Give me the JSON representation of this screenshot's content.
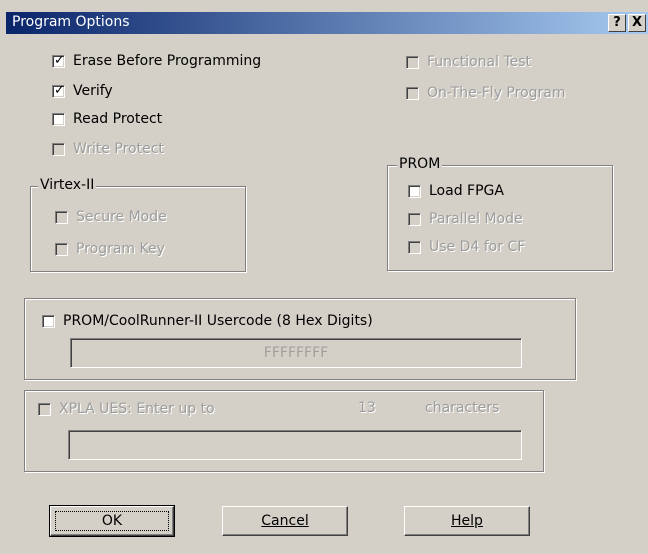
{
  "window": {
    "title": "Program Options",
    "help_button": "?",
    "close_button": "X"
  },
  "options": {
    "erase": {
      "label": "Erase Before Programming",
      "checked": true,
      "enabled": true
    },
    "verify": {
      "label": "Verify",
      "checked": true,
      "enabled": true
    },
    "read_protect": {
      "label": "Read Protect",
      "checked": false,
      "enabled": true
    },
    "write_protect": {
      "label": "Write Protect",
      "checked": false,
      "enabled": false
    },
    "functional_test": {
      "label": "Functional Test",
      "checked": false,
      "enabled": false
    },
    "on_the_fly": {
      "label": "On-The-Fly Program",
      "checked": false,
      "enabled": false
    }
  },
  "virtex": {
    "title": "Virtex-II",
    "secure_mode": {
      "label": "Secure Mode",
      "checked": false,
      "enabled": false
    },
    "program_key": {
      "label": "Program Key",
      "checked": false,
      "enabled": false
    }
  },
  "prom": {
    "title": "PROM",
    "load_fpga": {
      "label": "Load FPGA",
      "checked": false,
      "enabled": true
    },
    "parallel_mode": {
      "label": "Parallel Mode",
      "checked": false,
      "enabled": false
    },
    "use_d4": {
      "label": "Use D4 for CF",
      "checked": false,
      "enabled": false
    }
  },
  "usercode": {
    "label": "PROM/CoolRunner-II Usercode (8 Hex Digits)",
    "checked": false,
    "value": "FFFFFFFF"
  },
  "xpla": {
    "label": "XPLA UES: Enter up to",
    "count": "13",
    "suffix": "characters",
    "value": ""
  },
  "buttons": {
    "ok": "OK",
    "cancel": "Cancel",
    "help": "Help"
  }
}
